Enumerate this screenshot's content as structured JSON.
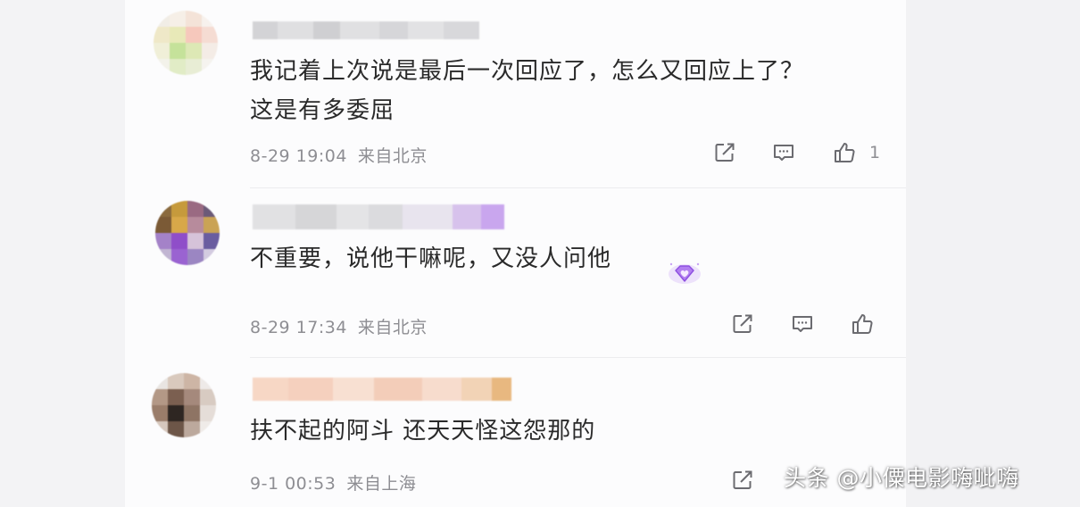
{
  "comments": [
    {
      "text_line1": "我记着上次说是最后一次回应了，怎么又回应上了？",
      "text_line2": "这是有多委屈",
      "date": "8-29 19:04",
      "location": "来自北京",
      "like_count": "1"
    },
    {
      "text_line1": "不重要，说他干嘛呢，又没人问他",
      "date": "8-29 17:34",
      "location": "来自北京",
      "badge_icon": "purple-diamond-heart-icon"
    },
    {
      "text_line1": "扶不起的阿斗 还天天怪这怨那的",
      "date": "9-1 00:53",
      "location": "来自上海"
    }
  ],
  "watermark": "头条 @小僳电影嗨呲嗨",
  "icons": {
    "share": "share-icon",
    "comment": "comment-icon",
    "like": "thumbs-up-icon"
  },
  "colors": {
    "text": "#2a2a2a",
    "meta": "#8e8e93",
    "background": "#fcfcfd",
    "icon": "#6b6b70"
  }
}
